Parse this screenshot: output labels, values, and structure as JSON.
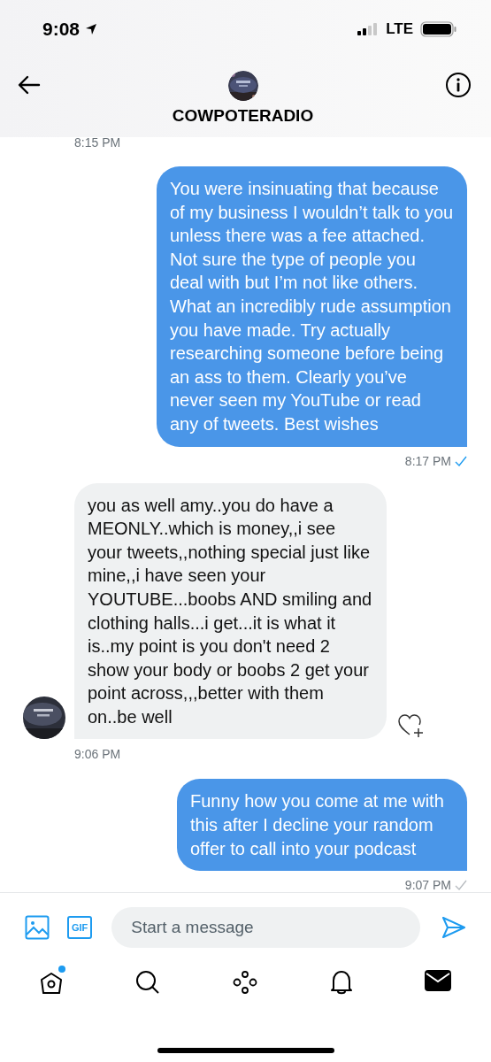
{
  "status_bar": {
    "time": "9:08",
    "network": "LTE"
  },
  "header": {
    "title": "COWPOTERADIO"
  },
  "messages": [
    {
      "kind": "timestamp",
      "text": "8:15 PM"
    },
    {
      "kind": "sent",
      "text": "You were insinuating that because of my business I wouldn’t talk to you unless there was a fee attached. Not sure the type of people you deal with but I’m not like others. What an incredibly rude assumption you have made. Try actually researching someone before being an ass to them. Clearly you’ve never seen my YouTube or read any of tweets. Best wishes",
      "time": "8:17 PM",
      "seen": true
    },
    {
      "kind": "received",
      "text": "you as well amy..you do have a MEONLY..which is money,,i see your tweets,,nothing special just like mine,,i have seen your YOUTUBE...boobs AND smiling and clothing halls...i get...it is what it is..my point is you don't need 2 show your body or boobs 2 get your point across,,,better with them on..be well",
      "time": "9:06 PM"
    },
    {
      "kind": "sent",
      "text": "Funny how you come at me with this after I decline your random offer to call into your podcast",
      "time": "9:07 PM",
      "seen": false
    }
  ],
  "composer": {
    "placeholder": "Start a message",
    "gif_label": "GIF"
  },
  "nav": [
    {
      "kind": "home",
      "selected": false,
      "badge": true
    },
    {
      "kind": "search",
      "selected": false,
      "badge": false
    },
    {
      "kind": "spaces",
      "selected": false,
      "badge": false
    },
    {
      "kind": "notifications",
      "selected": false,
      "badge": false
    },
    {
      "kind": "messages",
      "selected": true,
      "badge": false
    }
  ]
}
